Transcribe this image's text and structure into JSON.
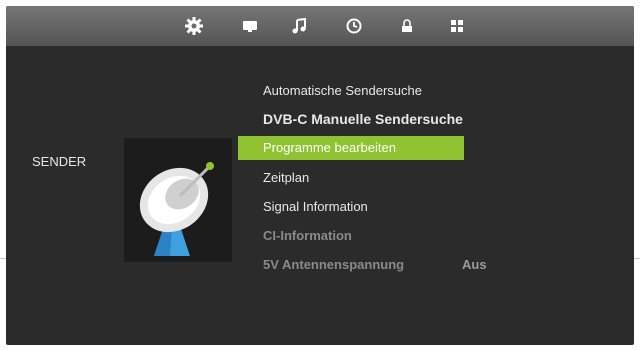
{
  "toolbar": {
    "icons": [
      "gear-icon",
      "tv-icon",
      "music-note-icon",
      "clock-icon",
      "lock-icon",
      "grid-icon"
    ]
  },
  "section": {
    "label": "SENDER"
  },
  "thumbnail": {
    "icon": "satellite-dish-icon"
  },
  "menu": {
    "items": [
      {
        "label": "Automatische Sendersuche"
      },
      {
        "label": "DVB-C Manuelle Sendersuche"
      },
      {
        "label": "Programme bearbeiten"
      },
      {
        "label": "Zeitplan"
      },
      {
        "label": "Signal Information"
      },
      {
        "label": "CI-Information"
      },
      {
        "label": "5V Antennenspannung",
        "value": "Aus"
      }
    ]
  },
  "colors": {
    "accent": "#8fc331",
    "panel": "#2b2b2b",
    "topbar": "#666666"
  }
}
